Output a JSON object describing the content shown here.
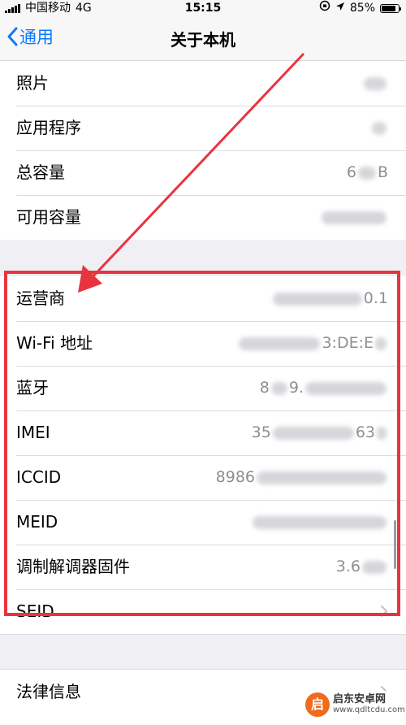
{
  "status_bar": {
    "carrier": "中国移动",
    "network": "4G",
    "time": "15:15",
    "battery_percent": "85%",
    "battery_level": 0.85
  },
  "nav": {
    "back_label": "通用",
    "title": "关于本机"
  },
  "group1": [
    {
      "label": "照片",
      "value": "",
      "value_tail": ""
    },
    {
      "label": "应用程序",
      "value": "",
      "value_tail": ""
    },
    {
      "label": "总容量",
      "value": "6",
      "value_tail": "B"
    },
    {
      "label": "可用容量",
      "value": "",
      "value_tail": ""
    }
  ],
  "group2": [
    {
      "label": "运营商",
      "value": "",
      "value_tail": "0.1"
    },
    {
      "label": "Wi-Fi 地址",
      "value": "",
      "value_tail": "3:DE:E"
    },
    {
      "label": "蓝牙",
      "value": "8",
      "value_tail": "9."
    },
    {
      "label": "IMEI",
      "value": "35",
      "value_tail": "63"
    },
    {
      "label": "ICCID",
      "value": "8986",
      "value_tail": ""
    },
    {
      "label": "MEID",
      "value": "",
      "value_tail": ""
    },
    {
      "label": "调制解调器固件",
      "value": "3.6",
      "value_tail": ""
    },
    {
      "label": "SEID",
      "value": "",
      "value_tail": ""
    }
  ],
  "group3": [
    {
      "label": "法律信息"
    }
  ],
  "watermark": {
    "name": "启东安卓网",
    "url": "www.qdltcdu.com"
  },
  "colors": {
    "accent": "#0a7aff",
    "highlight": "#e8343f",
    "background": "#efeff4"
  }
}
